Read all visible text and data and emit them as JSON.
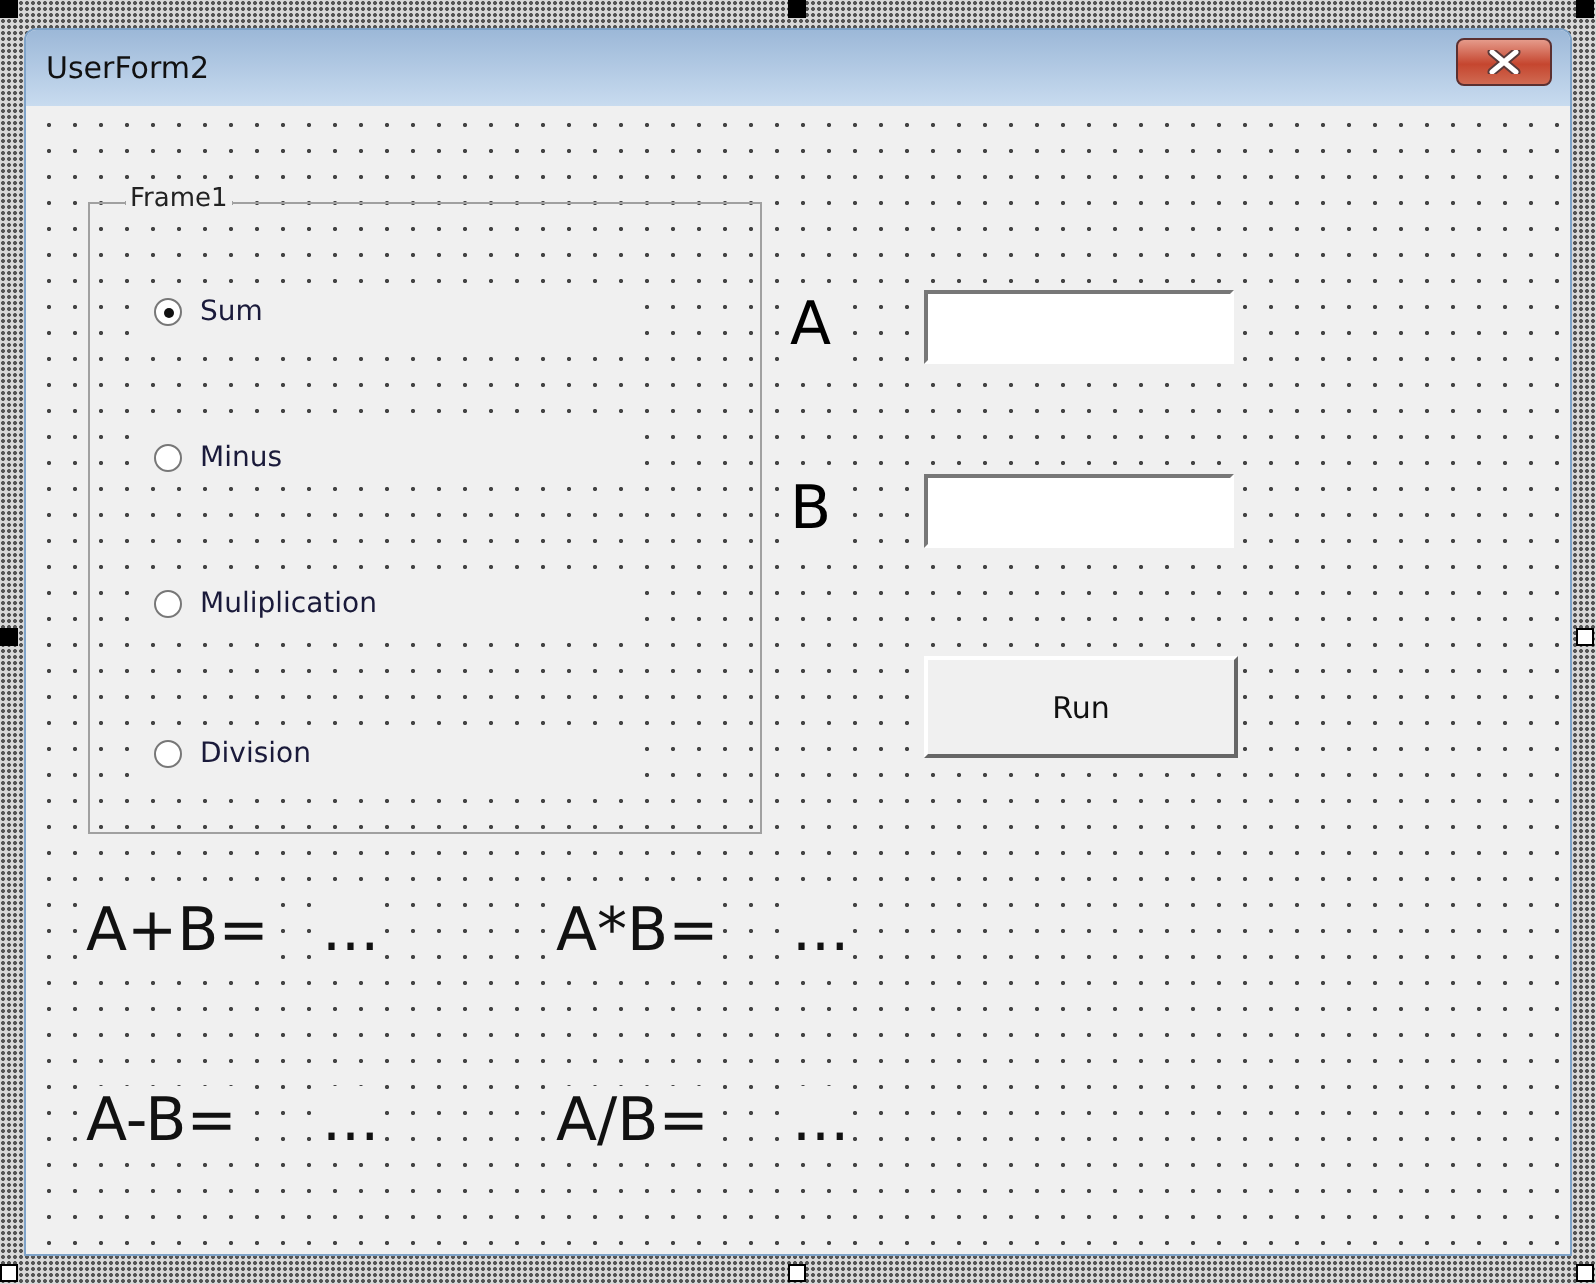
{
  "window": {
    "title": "UserForm2"
  },
  "frame": {
    "label": "Frame1",
    "options": [
      {
        "label": "Sum",
        "selected": true
      },
      {
        "label": "Minus",
        "selected": false
      },
      {
        "label": "Muliplication",
        "selected": false
      },
      {
        "label": "Division",
        "selected": false
      }
    ]
  },
  "inputs": [
    {
      "label": "A"
    },
    {
      "label": "B"
    }
  ],
  "button": {
    "label": "Run"
  },
  "results": [
    {
      "expression": "A+B=",
      "value": "..."
    },
    {
      "expression": "A*B=",
      "value": "..."
    },
    {
      "expression": "A-B=",
      "value": "..."
    },
    {
      "expression": "A/B=",
      "value": "..."
    }
  ]
}
